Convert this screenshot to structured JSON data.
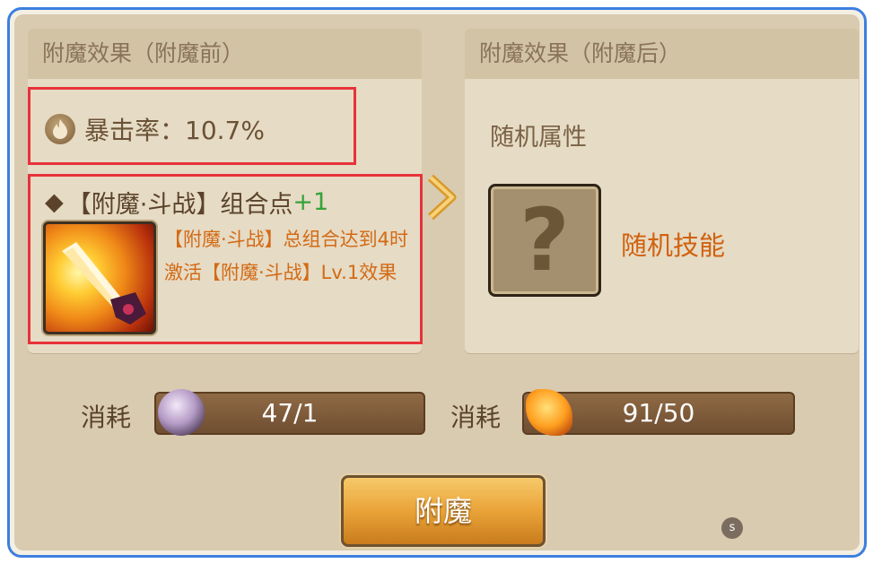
{
  "before_panel": {
    "title": "附魔效果（附魔前）",
    "crit": {
      "label": "暴击率：10.7%",
      "icon": "flame-icon"
    },
    "combo": {
      "bullet": "◆",
      "text": "【附魔·斗战】组合点",
      "plus": "+1"
    },
    "skill_icon": "sword-skill-icon",
    "skill_desc": "【附魔·斗战】总组合达到4时激活【附魔·斗战】Lv.1效果"
  },
  "after_panel": {
    "title": "附魔效果（附魔后）",
    "random_attr": "随机属性",
    "mystery_icon": "question-mark-icon",
    "random_skill": "随机技能"
  },
  "costs": [
    {
      "label": "消耗",
      "value": "47/1",
      "icon": "crystal-orb-icon"
    },
    {
      "label": "消耗",
      "value": "91/50",
      "icon": "fire-crystal-icon"
    }
  ],
  "enchant_button": "附魔",
  "badge": "s",
  "colors": {
    "frame_border": "#3d7fe0",
    "highlight_box": "#e8323a",
    "skill_text": "#d36a14",
    "combo_plus": "#36a23a",
    "button_gold": "#e9a338"
  }
}
